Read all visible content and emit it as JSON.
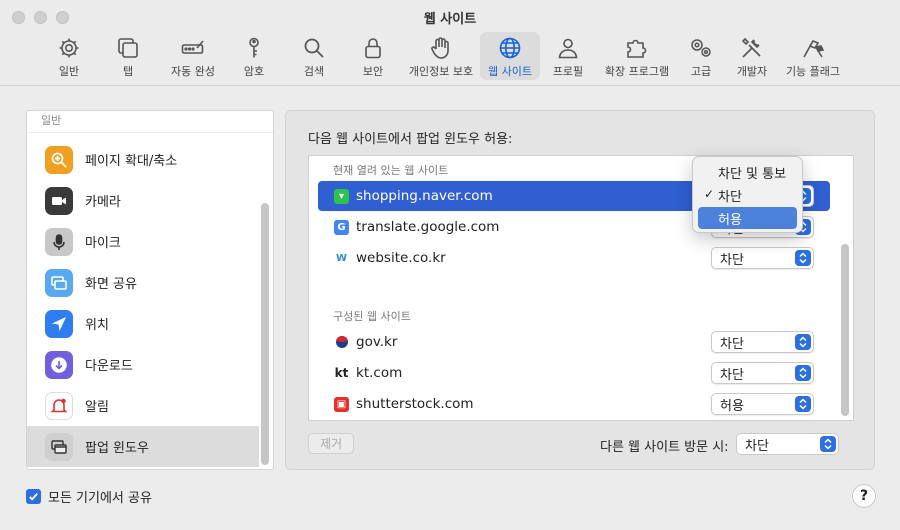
{
  "window": {
    "title": "웹 사이트"
  },
  "toolbar": {
    "items": [
      {
        "label": "일반",
        "icon": "gear-icon"
      },
      {
        "label": "탭",
        "icon": "tabs-icon"
      },
      {
        "label": "자동 완성",
        "icon": "autofill-icon"
      },
      {
        "label": "암호",
        "icon": "key-icon"
      },
      {
        "label": "검색",
        "icon": "search-icon"
      },
      {
        "label": "보안",
        "icon": "lock-icon"
      },
      {
        "label": "개인정보 보호",
        "icon": "hand-icon"
      },
      {
        "label": "웹 사이트",
        "icon": "globe-icon",
        "active": true
      },
      {
        "label": "프로필",
        "icon": "person-icon"
      },
      {
        "label": "확장 프로그램",
        "icon": "puzzle-icon"
      },
      {
        "label": "고급",
        "icon": "gears-icon"
      },
      {
        "label": "개발자",
        "icon": "tools-icon"
      },
      {
        "label": "기능 플래그",
        "icon": "flags-icon"
      }
    ]
  },
  "sidebar": {
    "section": "일반",
    "items": [
      {
        "label": "페이지 확대/축소",
        "icon": "zoom-icon",
        "color": "#f0a020"
      },
      {
        "label": "카메라",
        "icon": "camera-icon",
        "color": "#3a3a3a"
      },
      {
        "label": "마이크",
        "icon": "microphone-icon",
        "color": "#b8b8b8"
      },
      {
        "label": "화면 공유",
        "icon": "screen-share-icon",
        "color": "#5aa8f0"
      },
      {
        "label": "위치",
        "icon": "location-icon",
        "color": "#2f7ef0"
      },
      {
        "label": "다운로드",
        "icon": "download-icon",
        "color": "#7060e0"
      },
      {
        "label": "알림",
        "icon": "bell-icon",
        "color": "#ffffff"
      },
      {
        "label": "팝업 윈도우",
        "icon": "popup-window-icon",
        "color": "#cfcfcf",
        "selected": true
      }
    ]
  },
  "main": {
    "heading": "다음 웹 사이트에서 팝업 윈도우 허용:",
    "open_section": "현재 열려 있는 웹 사이트",
    "configured_section": "구성된 웹 사이트",
    "open_sites": [
      {
        "site": "shopping.naver.com",
        "value": "차단",
        "favicon": "naver-favicon",
        "selected": true
      },
      {
        "site": "translate.google.com",
        "value": "차단",
        "favicon": "google-translate-favicon"
      },
      {
        "site": "website.co.kr",
        "value": "차단",
        "favicon": "website-favicon"
      }
    ],
    "configured_sites": [
      {
        "site": "gov.kr",
        "value": "차단",
        "favicon": "gov-favicon"
      },
      {
        "site": "kt.com",
        "value": "차단",
        "favicon": "kt-favicon"
      },
      {
        "site": "shutterstock.com",
        "value": "허용",
        "favicon": "shutterstock-favicon"
      }
    ],
    "remove_label": "제거",
    "other_label": "다른 웹 사이트 방문 시:",
    "other_value": "차단"
  },
  "popup_menu": {
    "items": [
      {
        "label": "차단 및 통보"
      },
      {
        "label": "차단",
        "checked": true
      },
      {
        "label": "허용",
        "highlighted": true
      }
    ],
    "check_mark": "✓"
  },
  "footer": {
    "share_label": "모든 기기에서 공유",
    "help_label": "?"
  },
  "colors": {
    "accent": "#2b6fe0",
    "selection": "#2f5fd0"
  }
}
